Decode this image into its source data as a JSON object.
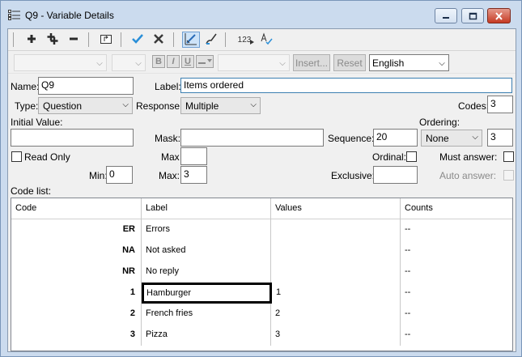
{
  "window": {
    "title": "Q9 - Variable Details",
    "controls": [
      "minimize-icon",
      "maximize-icon",
      "close-icon"
    ]
  },
  "toolbar": {
    "buttons": [
      "add-icon",
      "add-multiple-icon",
      "remove-icon",
      "move-up-level-icon",
      "accept-check-icon",
      "cancel-x-icon",
      "grid-edit-icon",
      "brush-check-icon",
      "numbering-123-icon",
      "spellcheck-icon"
    ],
    "numbering_label": "123"
  },
  "format_bar": {
    "bold": "B",
    "italic": "I",
    "underline": "U",
    "insert_label": "Insert...",
    "reset_label": "Reset",
    "language": "English"
  },
  "form": {
    "name_label": "Name:",
    "name_value": "Q9",
    "label_label": "Label:",
    "label_value": "Items ordered",
    "type_label": "Type:",
    "type_value": "Question",
    "response_label": "Response:",
    "response_value": "Multiple",
    "codes_label": "Codes:",
    "codes_value": "3",
    "initial_value_label": "Initial Value:",
    "initial_value": "",
    "mask_label": "Mask:",
    "mask_value": "",
    "sequence_label": "Sequence:",
    "sequence_value": "20",
    "ordering_label": "Ordering:",
    "ordering_value": "None",
    "ordering_number": "3",
    "read_only_label": "Read Only",
    "max_label_top": "Max",
    "max_top_value": "",
    "ordinal_label": "Ordinal:",
    "must_answer_label": "Must answer:",
    "min_label": "Min:",
    "min_value": "0",
    "max_label": "Max:",
    "max_value": "3",
    "exclusive_label": "Exclusive:",
    "exclusive_value": "",
    "auto_answer_label": "Auto answer:",
    "code_list_label": "Code list:"
  },
  "code_list": {
    "columns": [
      "Code",
      "Label",
      "Values",
      "Counts"
    ],
    "rows": [
      {
        "code": "ER",
        "label": "Errors",
        "values": "",
        "counts": "--"
      },
      {
        "code": "NA",
        "label": "Not asked",
        "values": "",
        "counts": "--"
      },
      {
        "code": "NR",
        "label": "No reply",
        "values": "",
        "counts": "--"
      },
      {
        "code": "1",
        "label": "Hamburger",
        "values": "1",
        "counts": "--"
      },
      {
        "code": "2",
        "label": "French fries",
        "values": "2",
        "counts": "--"
      },
      {
        "code": "3",
        "label": "Pizza",
        "values": "3",
        "counts": "--"
      }
    ],
    "selected_row": 3
  },
  "colors": {
    "title_bar": "#cbdbee",
    "accept_check": "#2a8fd8",
    "cancel_x": "#3a3a3a",
    "close_button": "#c63a23"
  }
}
